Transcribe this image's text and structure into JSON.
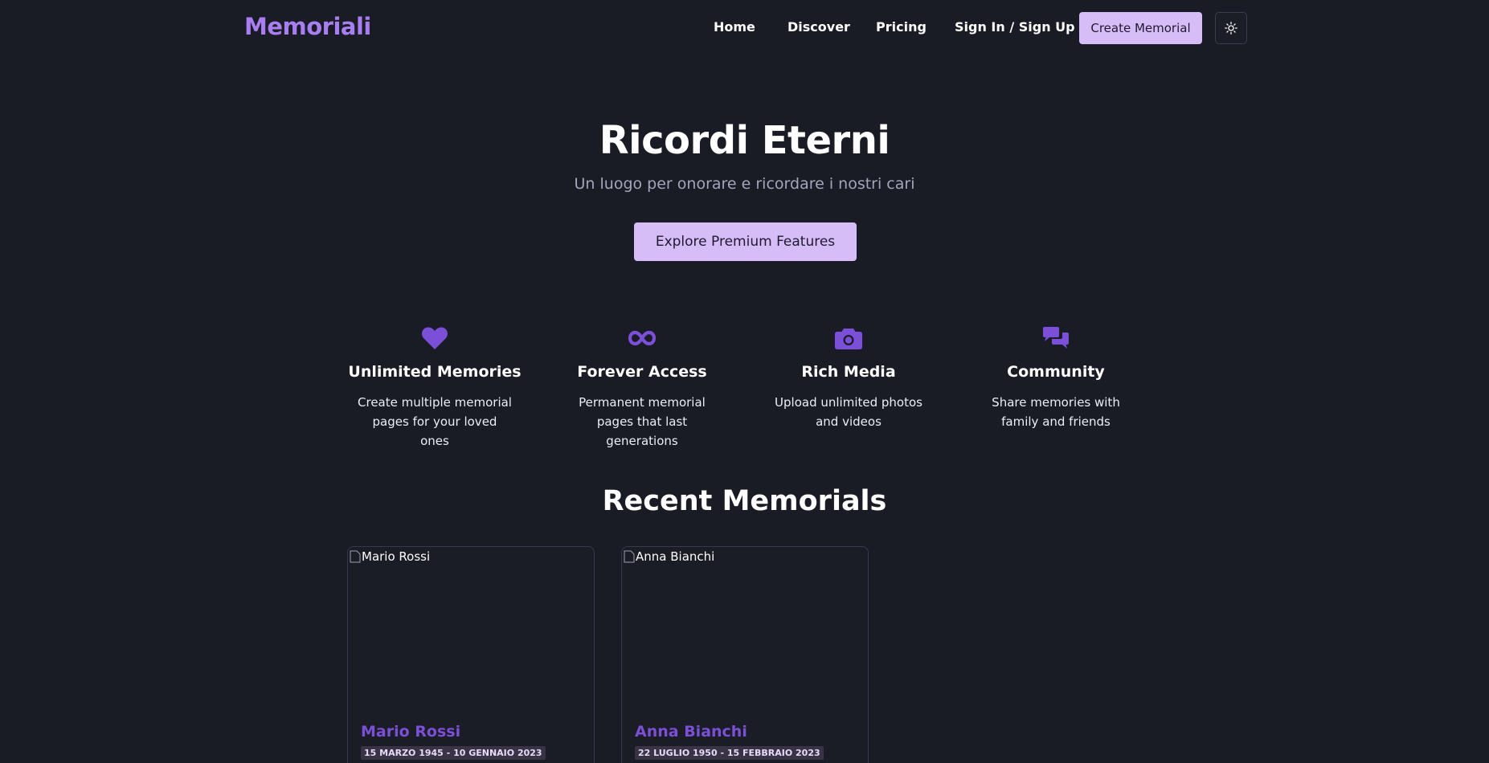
{
  "header": {
    "logo": "Memoriali",
    "nav": {
      "home": "Home",
      "discover": "Discover",
      "pricing": "Pricing",
      "signin": "Sign In / Sign Up"
    },
    "create_label": "Create Memorial",
    "theme_icon": "sun-icon"
  },
  "hero": {
    "title": "Ricordi Eterni",
    "subtitle": "Un luogo per onorare e ricordare i nostri cari",
    "cta_label": "Explore Premium Features"
  },
  "features": [
    {
      "icon": "heart-icon",
      "title": "Unlimited Memories",
      "desc": "Create multiple memorial pages for your loved ones"
    },
    {
      "icon": "infinity-icon",
      "title": "Forever Access",
      "desc": "Permanent memorial pages that last generations"
    },
    {
      "icon": "camera-icon",
      "title": "Rich Media",
      "desc": "Upload unlimited photos and videos"
    },
    {
      "icon": "comments-icon",
      "title": "Community",
      "desc": "Share memories with family and friends"
    }
  ],
  "recent": {
    "title": "Recent Memorials",
    "cards": [
      {
        "image_alt": "Mario Rossi",
        "name": "Mario Rossi",
        "dates": "15 MARZO 1945 - 10 GENNAIO 2023"
      },
      {
        "image_alt": "Anna Bianchi",
        "name": "Anna Bianchi",
        "dates": "22 LUGLIO 1950 - 15 FEBBRAIO 2023"
      }
    ]
  },
  "colors": {
    "background": "#191b25",
    "accent": "#d7bdf8",
    "logo": "#a87ef0",
    "icon": "#7c4fd8",
    "card_name": "#7b4fd6"
  }
}
